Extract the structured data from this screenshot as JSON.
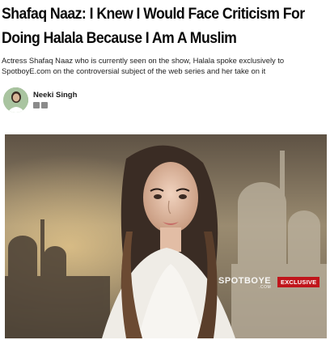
{
  "article": {
    "headline": "Shafaq Naaz: I Knew I Would Face Criticism For Doing Halala Because I Am A Muslim",
    "summary": "Actress Shafaq Naaz who is currently seen on the show, Halala spoke exclusively to SpotboyE.com on the controversial subject of the web series and her take on it"
  },
  "author": {
    "name": "Neeki Singh",
    "social_icons": [
      "mail-icon",
      "twitter-icon"
    ]
  },
  "hero": {
    "watermark": "SPOTBOYE",
    "watermark_domain": ".COM",
    "badge": "EXCLUSIVE"
  }
}
